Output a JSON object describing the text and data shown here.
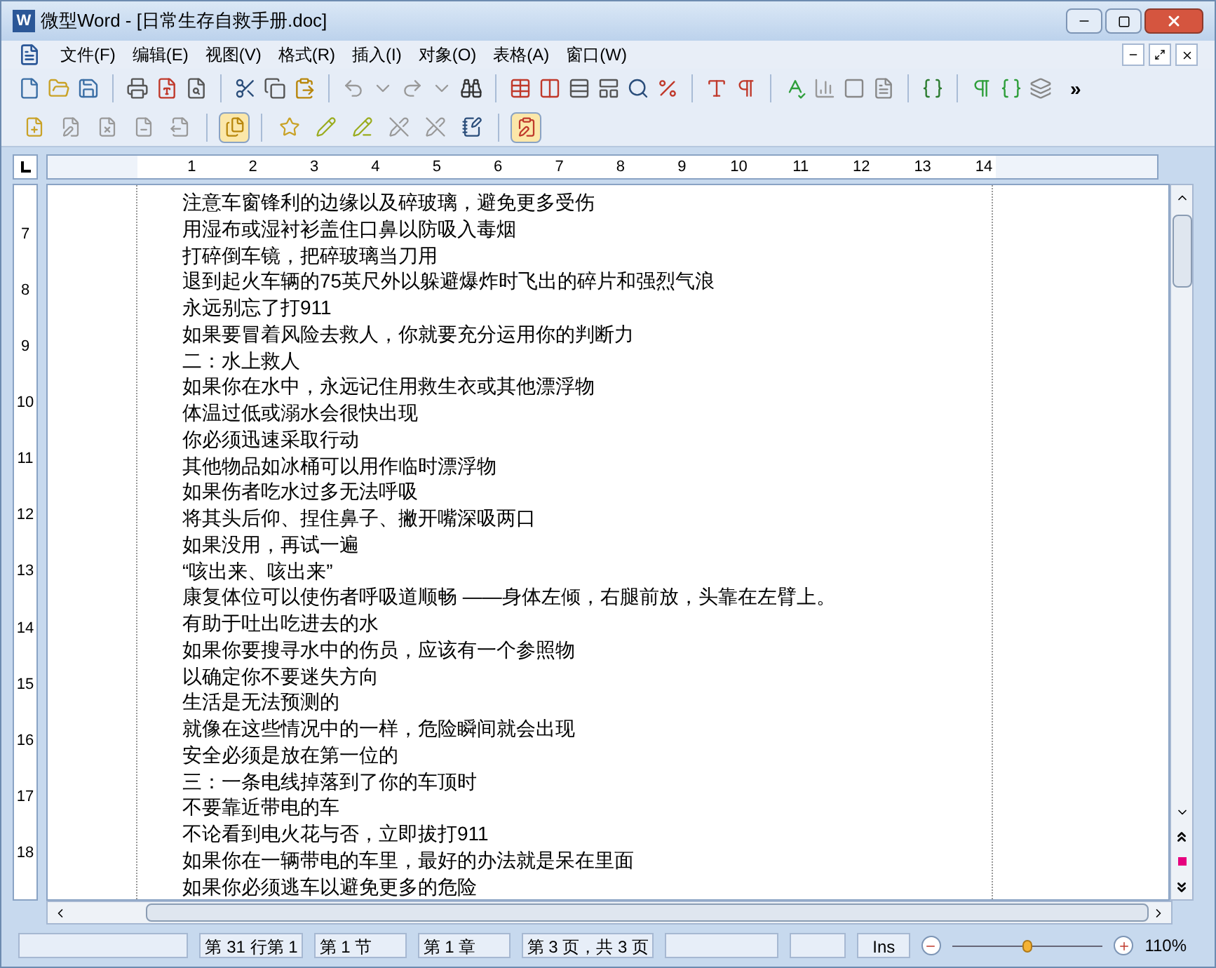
{
  "window": {
    "icon_letter": "W",
    "title": "微型Word - [日常生存自救手册.doc]"
  },
  "menu": [
    "文件(F)",
    "编辑(E)",
    "视图(V)",
    "格式(R)",
    "插入(I)",
    "对象(O)",
    "表格(A)",
    "窗口(W)"
  ],
  "toolbar_overflow": "»",
  "toolbar_2": [
    {
      "selected": false
    },
    {
      "selected": false
    },
    {
      "selected": false
    },
    {
      "selected": false
    },
    {
      "selected": false
    },
    {
      "selected": true
    },
    {
      "selected": false
    },
    {
      "selected": false
    },
    {
      "selected": false
    },
    {
      "selected": false
    },
    {
      "selected": false
    },
    {
      "selected": false
    },
    {
      "selected": true
    }
  ],
  "ruler": [
    "1",
    "2",
    "3",
    "4",
    "5",
    "6",
    "7",
    "8",
    "9",
    "10",
    "11",
    "12",
    "13",
    "14"
  ],
  "vertical_ruler": [
    "7",
    "8",
    "9",
    "10",
    "11",
    "12",
    "13",
    "14",
    "15",
    "16",
    "17",
    "18"
  ],
  "document_lines": [
    "注意车窗锋利的边缘以及碎玻璃，避免更多受伤",
    "用湿布或湿衬衫盖住口鼻以防吸入毒烟",
    "打碎倒车镜，把碎玻璃当刀用",
    "退到起火车辆的75英尺外以躲避爆炸时飞出的碎片和强烈气浪",
    "永远别忘了打911",
    "如果要冒着风险去救人，你就要充分运用你的判断力",
    "二：水上救人",
    "如果你在水中，永远记住用救生衣或其他漂浮物",
    "体温过低或溺水会很快出现",
    "你必须迅速采取行动",
    "其他物品如冰桶可以用作临时漂浮物",
    "如果伤者吃水过多无法呼吸",
    "将其头后仰、捏住鼻子、撇开嘴深吸两口",
    "如果没用，再试一遍",
    "“咳出来、咳出来”",
    "康复体位可以使伤者呼吸道顺畅 ——身体左倾，右腿前放，头靠在左臂上。",
    "有助于吐出吃进去的水",
    "如果你要搜寻水中的伤员，应该有一个参照物",
    "以确定你不要迷失方向",
    "生活是无法预测的",
    "就像在这些情况中的一样，危险瞬间就会出现",
    "安全必须是放在第一位的",
    "三：一条电线掉落到了你的车顶时",
    "不要靠近带电的车",
    "不论看到电火花与否，立即拔打911",
    "如果你在一辆带电的车里，最好的办法就是呆在里面",
    "如果你必须逃车以避免更多的危险"
  ],
  "status_bar": {
    "fields": [
      "第 31 行第 1",
      "第 1 节",
      "第 1 章",
      "第 3 页，共 3 页"
    ],
    "mode": "Ins",
    "zoom": "110%",
    "level": 0.5
  }
}
